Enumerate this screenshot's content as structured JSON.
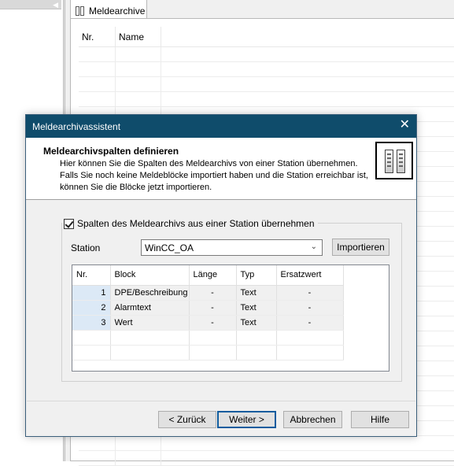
{
  "background": {
    "tab_label": "Meldearchive",
    "grid_headers": [
      "Nr.",
      "Name"
    ]
  },
  "dialog": {
    "title": "Meldearchivassistent",
    "close_glyph": "✕",
    "header": {
      "title": "Meldearchivspalten definieren",
      "desc_line1": "Hier können Sie die Spalten des Meldearchivs von einer Station übernehmen.",
      "desc_line2": "Falls Sie noch keine Meldeblöcke importiert haben und die Station erreichbar ist,",
      "desc_line3": "können Sie die Blöcke jetzt importieren."
    },
    "checkbox_label": "Spalten des Meldearchivs aus einer Station übernehmen",
    "checkbox_checked": true,
    "station_label": "Station",
    "station_value": "WinCC_OA",
    "import_button": "Importieren",
    "table": {
      "headers": [
        "Nr.",
        "Block",
        "Länge",
        "Typ",
        "Ersatzwert"
      ],
      "rows": [
        {
          "nr": "1",
          "block": "DPE/Beschreibung",
          "laenge": "-",
          "typ": "Text",
          "ersatz": "-"
        },
        {
          "nr": "2",
          "block": "Alarmtext",
          "laenge": "-",
          "typ": "Text",
          "ersatz": "-"
        },
        {
          "nr": "3",
          "block": "Wert",
          "laenge": "-",
          "typ": "Text",
          "ersatz": "-"
        }
      ]
    },
    "buttons": {
      "back": "< Zurück",
      "next": "Weiter >",
      "cancel": "Abbrechen",
      "help": "Hilfe"
    }
  }
}
